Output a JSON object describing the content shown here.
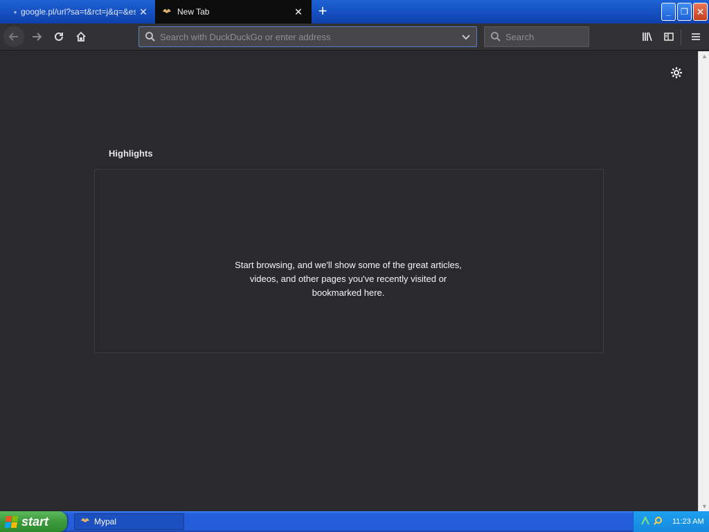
{
  "tabs": [
    {
      "title": "google.pl/url?sa=t&rct=j&q=&esrc",
      "favicon": "google-favicon"
    },
    {
      "title": "New Tab",
      "favicon": "mypal-favicon"
    }
  ],
  "new_tab_icon": "plus-icon",
  "window_controls": {
    "minimize": "_",
    "maximize": "❐",
    "close": "✕"
  },
  "toolbar": {
    "url_placeholder": "Search with DuckDuckGo or enter address",
    "search_placeholder": "Search"
  },
  "content": {
    "highlights_title": "Highlights",
    "highlights_empty": "Start browsing, and we'll show some of the great articles, videos, and other pages you've recently visited or bookmarked here."
  },
  "taskbar": {
    "start_label": "start",
    "item_label": "Mypal",
    "clock": "11:23 AM"
  },
  "colors": {
    "titlebar": "#1650c2",
    "active_tab": "#0c0c0d",
    "toolbar": "#323234",
    "content_bg": "#2a2a2e",
    "taskbar": "#245edb",
    "start_button": "#3c9a3c"
  }
}
